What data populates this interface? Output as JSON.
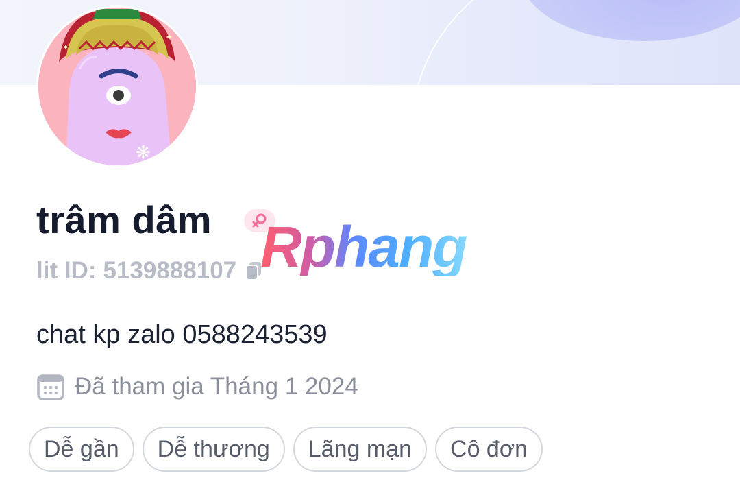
{
  "profile": {
    "name": "trâm dâm",
    "id_prefix": "lit ID:",
    "id_value": "5139888107",
    "bio": "chat kp zalo 0588243539",
    "joined": "Đã tham gia Tháng 1 2024",
    "gender_icon": "female-icon",
    "tags": [
      "Dễ gần",
      "Dễ thương",
      "Lãng mạn",
      "Cô đơn"
    ]
  },
  "watermark": {
    "text": "Rphang"
  },
  "colors": {
    "name": "#161c2d",
    "id_text": "#b8bcc7",
    "muted_text": "#8a8f9b",
    "tag_border": "#d4d7de",
    "gender_badge_bg": "#ffe6ee",
    "gender_icon": "#f56b9a",
    "avatar_bg": "#fbb4be",
    "avatar_character": "#e9c3f7"
  },
  "icons": {
    "copy": "copy-icon",
    "calendar": "calendar-icon"
  }
}
